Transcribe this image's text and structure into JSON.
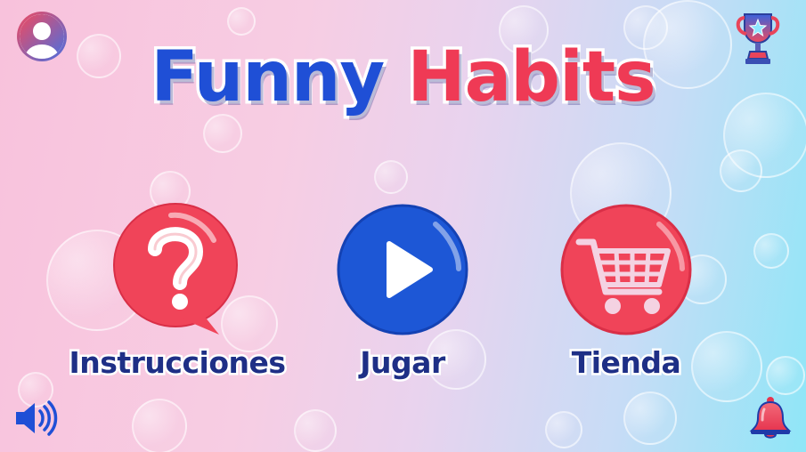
{
  "app": {
    "title_word1": "Funny",
    "title_word2": "Habits"
  },
  "menu": {
    "instructions_label": "Instrucciones",
    "play_label": "Jugar",
    "shop_label": "Tienda"
  },
  "icons": {
    "top_left": "user-profile-icon",
    "top_right": "trophy-icon",
    "bottom_left": "sound-icon",
    "bottom_right": "notification-bell-icon"
  },
  "colors": {
    "title_blue": "#1f4fd6",
    "title_red": "#ef3a55",
    "label_navy": "#1e2f86",
    "button_red": "#f04459",
    "button_blue": "#1d57d6"
  }
}
